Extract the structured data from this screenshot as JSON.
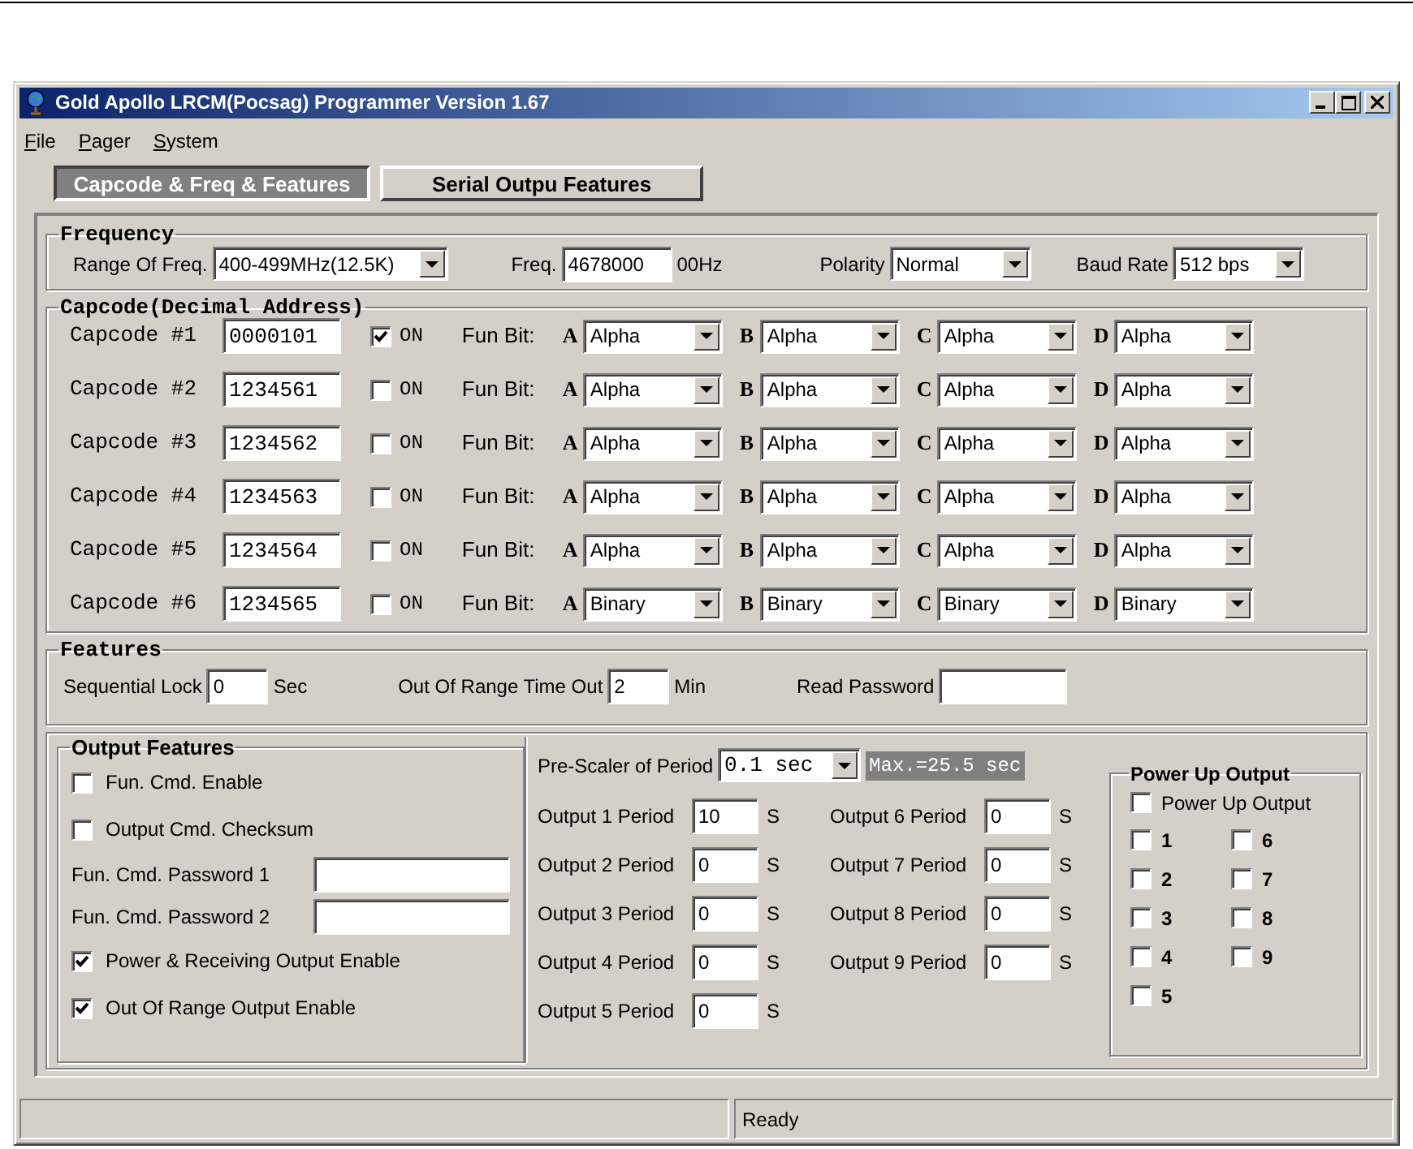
{
  "window": {
    "title": "Gold Apollo LRCM(Pocsag) Programmer Version 1.67"
  },
  "menu": [
    {
      "label": "File"
    },
    {
      "label": "Pager"
    },
    {
      "label": "System"
    }
  ],
  "tabs": [
    {
      "label": "Capcode & Freq & Features",
      "selected": true
    },
    {
      "label": "Serial Outpu Features",
      "selected": false
    }
  ],
  "frequency": {
    "title": "Frequency",
    "fields": [
      {
        "kind": "select",
        "label": "Range Of Freq.",
        "value": "400-499MHz(12.5K)"
      },
      {
        "kind": "text",
        "label": "Freq.",
        "value": "4678000",
        "unit": "00Hz"
      },
      {
        "kind": "select",
        "label": "Polarity",
        "value": "Normal"
      },
      {
        "kind": "select",
        "label": "Baud Rate",
        "value": "512 bps"
      }
    ]
  },
  "capcode": {
    "title": "Capcode(Decimal Address)",
    "rows": [
      {
        "label": "Capcode #1",
        "value": "0000101",
        "on": true,
        "on_label": "ON",
        "fun_label": "Fun Bit:",
        "bits": [
          {
            "letter": "A",
            "value": "Alpha"
          },
          {
            "letter": "B",
            "value": "Alpha"
          },
          {
            "letter": "C",
            "value": "Alpha"
          },
          {
            "letter": "D",
            "value": "Alpha"
          }
        ]
      },
      {
        "label": "Capcode #2",
        "value": "1234561",
        "on": false,
        "on_label": "ON",
        "fun_label": "Fun Bit:",
        "bits": [
          {
            "letter": "A",
            "value": "Alpha"
          },
          {
            "letter": "B",
            "value": "Alpha"
          },
          {
            "letter": "C",
            "value": "Alpha"
          },
          {
            "letter": "D",
            "value": "Alpha"
          }
        ]
      },
      {
        "label": "Capcode #3",
        "value": "1234562",
        "on": false,
        "on_label": "ON",
        "fun_label": "Fun Bit:",
        "bits": [
          {
            "letter": "A",
            "value": "Alpha"
          },
          {
            "letter": "B",
            "value": "Alpha"
          },
          {
            "letter": "C",
            "value": "Alpha"
          },
          {
            "letter": "D",
            "value": "Alpha"
          }
        ]
      },
      {
        "label": "Capcode #4",
        "value": "1234563",
        "on": false,
        "on_label": "ON",
        "fun_label": "Fun Bit:",
        "bits": [
          {
            "letter": "A",
            "value": "Alpha"
          },
          {
            "letter": "B",
            "value": "Alpha"
          },
          {
            "letter": "C",
            "value": "Alpha"
          },
          {
            "letter": "D",
            "value": "Alpha"
          }
        ]
      },
      {
        "label": "Capcode #5",
        "value": "1234564",
        "on": false,
        "on_label": "ON",
        "fun_label": "Fun Bit:",
        "bits": [
          {
            "letter": "A",
            "value": "Alpha"
          },
          {
            "letter": "B",
            "value": "Alpha"
          },
          {
            "letter": "C",
            "value": "Alpha"
          },
          {
            "letter": "D",
            "value": "Alpha"
          }
        ]
      },
      {
        "label": "Capcode #6",
        "value": "1234565",
        "on": false,
        "on_label": "ON",
        "fun_label": "Fun Bit:",
        "bits": [
          {
            "letter": "A",
            "value": "Binary"
          },
          {
            "letter": "B",
            "value": "Binary"
          },
          {
            "letter": "C",
            "value": "Binary"
          },
          {
            "letter": "D",
            "value": "Binary"
          }
        ]
      }
    ]
  },
  "features": {
    "title": "Features",
    "fields": [
      {
        "label": "Sequential Lock",
        "value": "0",
        "unit": "Sec"
      },
      {
        "label": "Out Of Range Time Out",
        "value": "2",
        "unit": "Min"
      },
      {
        "label": "Read Password"
      }
    ]
  },
  "output_features": {
    "title": "Output Features",
    "items": [
      {
        "kind": "checkbox",
        "label": "Fun. Cmd. Enable",
        "checked": false
      },
      {
        "kind": "checkbox",
        "label": "Output Cmd. Checksum",
        "checked": false
      },
      {
        "kind": "password",
        "label": "Fun. Cmd. Password 1"
      },
      {
        "kind": "password",
        "label": "Fun. Cmd. Password 2"
      },
      {
        "kind": "checkbox",
        "label": "Power & Receiving Output Enable",
        "checked": true
      },
      {
        "kind": "checkbox",
        "label": "Out Of Range Output Enable",
        "checked": true
      }
    ]
  },
  "periods": {
    "prescaler_label": "Pre-Scaler of Period",
    "prescaler_value": "0.1 sec",
    "max_note": "Max.=25.5 sec",
    "outputs": [
      {
        "label": "Output 1 Period",
        "value": "10",
        "unit": "S"
      },
      {
        "label": "Output 2 Period",
        "value": "0",
        "unit": "S"
      },
      {
        "label": "Output 3 Period",
        "value": "0",
        "unit": "S"
      },
      {
        "label": "Output 4 Period",
        "value": "0",
        "unit": "S"
      },
      {
        "label": "Output 5 Period",
        "value": "0",
        "unit": "S"
      },
      {
        "label": "Output 6 Period",
        "value": "0",
        "unit": "S"
      },
      {
        "label": "Output 7 Period",
        "value": "0",
        "unit": "S"
      },
      {
        "label": "Output 8 Period",
        "value": "0",
        "unit": "S"
      },
      {
        "label": "Output 9 Period",
        "value": "0",
        "unit": "S"
      }
    ]
  },
  "power_up": {
    "title": "Power Up Output",
    "master": {
      "label": "Power Up Output",
      "checked": false
    },
    "outputs": [
      {
        "label": "1",
        "checked": false
      },
      {
        "label": "2",
        "checked": false
      },
      {
        "label": "3",
        "checked": false
      },
      {
        "label": "4",
        "checked": false
      },
      {
        "label": "5",
        "checked": false
      },
      {
        "label": "6",
        "checked": false
      },
      {
        "label": "7",
        "checked": false
      },
      {
        "label": "8",
        "checked": false
      },
      {
        "label": "9",
        "checked": false
      }
    ]
  },
  "status_bar": {
    "text": "Ready"
  }
}
